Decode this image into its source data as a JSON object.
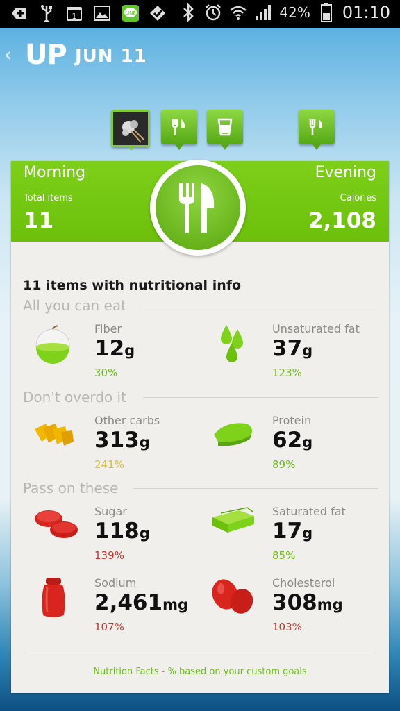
{
  "status_bar": {
    "battery": "42%",
    "time": "01:10",
    "icons": [
      "add-icon",
      "usb-icon",
      "calendar-icon",
      "image-icon",
      "line-app-icon",
      "check-app-icon",
      "bluetooth-icon",
      "alarm-icon",
      "wifi-icon",
      "signal-icon",
      "battery-icon"
    ],
    "calendar_day": "1"
  },
  "header": {
    "logo": "UP",
    "date": "JUN 11"
  },
  "timeline": {
    "markers": [
      "photo-marker",
      "meal-marker",
      "drink-marker",
      "meal-marker"
    ]
  },
  "card": {
    "left_title": "Morning",
    "right_title": "Evening",
    "left_label": "Total items",
    "left_value": "11",
    "right_label": "Calories",
    "right_value": "2,108",
    "section_title": "11 items with nutritional info",
    "groups": [
      {
        "label": "All you can eat",
        "items": [
          {
            "name": "Fiber",
            "value": "12",
            "unit": "g",
            "pct": "30%",
            "pct_color": "#6cbf18",
            "icon": "apple-icon"
          },
          {
            "name": "Unsaturated fat",
            "value": "37",
            "unit": "g",
            "pct": "123%",
            "pct_color": "#6cbf18",
            "icon": "drops-icon"
          }
        ]
      },
      {
        "label": "Don't overdo it",
        "items": [
          {
            "name": "Other carbs",
            "value": "313",
            "unit": "g",
            "pct": "241%",
            "pct_color": "#d8c02c",
            "icon": "chips-icon"
          },
          {
            "name": "Protein",
            "value": "62",
            "unit": "g",
            "pct": "89%",
            "pct_color": "#6cbf18",
            "icon": "steak-icon"
          }
        ]
      },
      {
        "label": "Pass on these",
        "items": [
          {
            "name": "Sugar",
            "value": "118",
            "unit": "g",
            "pct": "139%",
            "pct_color": "#c0392b",
            "icon": "candy-icon"
          },
          {
            "name": "Saturated fat",
            "value": "17",
            "unit": "g",
            "pct": "85%",
            "pct_color": "#6cbf18",
            "icon": "butter-icon"
          },
          {
            "name": "Sodium",
            "value": "2,461",
            "unit": "mg",
            "pct": "107%",
            "pct_color": "#c0392b",
            "icon": "salt-shaker-icon"
          },
          {
            "name": "Cholesterol",
            "value": "308",
            "unit": "mg",
            "pct": "103%",
            "pct_color": "#c0392b",
            "icon": "egg-icon"
          }
        ]
      }
    ],
    "footer": "Nutrition Facts - % based on your custom goals"
  }
}
